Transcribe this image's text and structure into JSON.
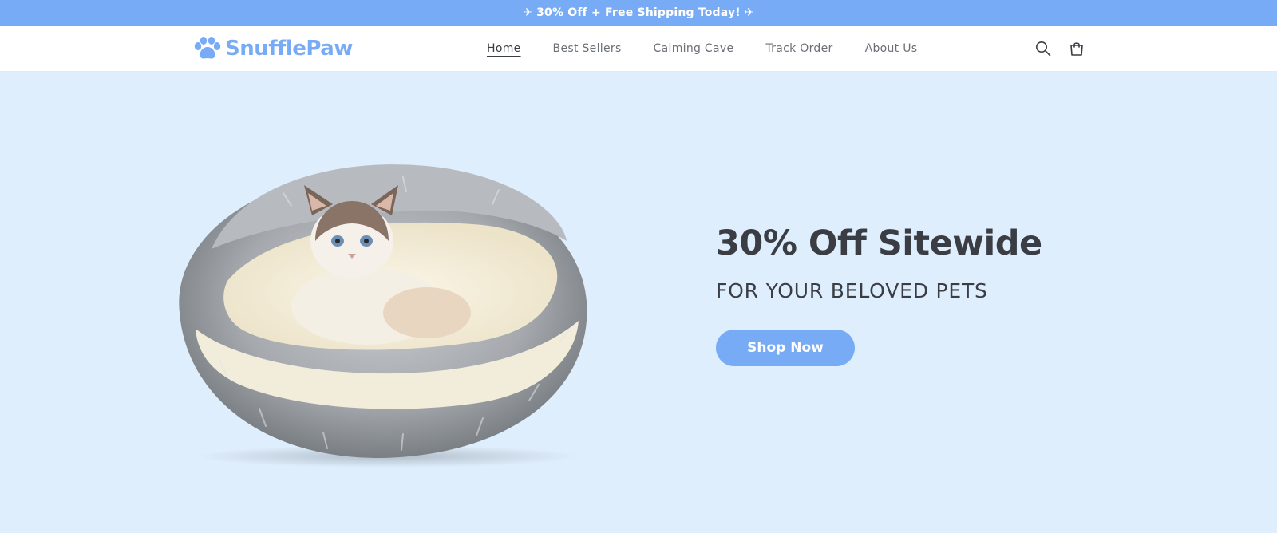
{
  "announcement": {
    "text": "✈ 30% Off + Free Shipping Today! ✈"
  },
  "header": {
    "logo_text": "SnufflePaw",
    "nav": [
      {
        "label": "Home",
        "active": true
      },
      {
        "label": "Best Sellers",
        "active": false
      },
      {
        "label": "Calming Cave",
        "active": false
      },
      {
        "label": "Track Order",
        "active": false
      },
      {
        "label": "About Us",
        "active": false
      }
    ],
    "icons": [
      "search-icon",
      "cart-icon"
    ]
  },
  "hero": {
    "title": "30% Off Sitewide",
    "subtitle": "FOR YOUR BELOVED PETS",
    "cta_label": "Shop Now",
    "image": "cat-in-fluffy-cave-bed"
  },
  "colors": {
    "accent": "#78abf5",
    "hero_bg": "#dfeefd",
    "text_dark": "#3a3d44",
    "nav_text": "#6b6f76"
  }
}
